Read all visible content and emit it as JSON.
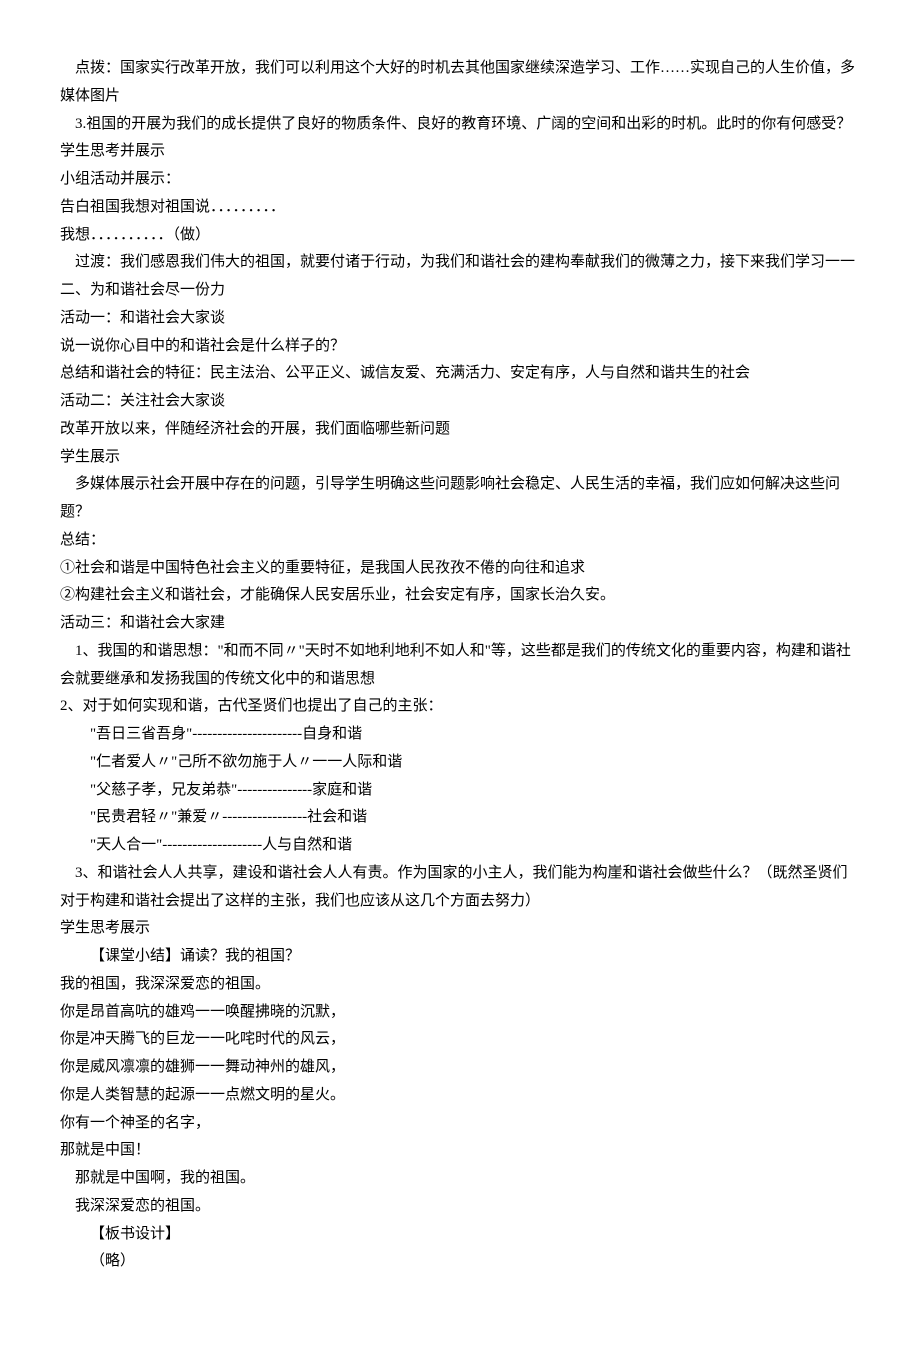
{
  "lines": [
    {
      "cls": "indent1",
      "text": "点拨：国家实行改革开放，我们可以利用这个大好的时机去其他国家继续深造学习、工作……实现自己的人生价值，多媒体图片"
    },
    {
      "cls": "indent1",
      "text": "3.祖国的开展为我们的成长提供了良好的物质条件、良好的教育环境、广阔的空间和出彩的时机。此时的你有何感受？"
    },
    {
      "cls": "",
      "text": "学生思考并展示"
    },
    {
      "cls": "",
      "text": "小组活动并展示："
    },
    {
      "cls": "",
      "text": "告白祖国我想对祖国说．．．．．．．．．"
    },
    {
      "cls": "",
      "text": "我想．．．．．．．．．．（做）"
    },
    {
      "cls": "indent1",
      "text": "过渡：我们感恩我们伟大的祖国，就要付诸于行动，为我们和谐社会的建构奉献我们的微薄之力，接下来我们学习一一"
    },
    {
      "cls": "",
      "text": "二、为和谐社会尽一份力"
    },
    {
      "cls": "",
      "text": "活动一：和谐社会大家谈"
    },
    {
      "cls": "",
      "text": "说一说你心目中的和谐社会是什么样子的？"
    },
    {
      "cls": "",
      "text": "总结和谐社会的特征：民主法治、公平正义、诚信友爱、充满活力、安定有序，人与自然和谐共生的社会"
    },
    {
      "cls": "",
      "text": "活动二：关注社会大家谈"
    },
    {
      "cls": "",
      "text": "改革开放以来，伴随经济社会的开展，我们面临哪些新问题"
    },
    {
      "cls": "",
      "text": "学生展示"
    },
    {
      "cls": "indent1",
      "text": "多媒体展示社会开展中存在的问题，引导学生明确这些问题影响社会稳定、人民生活的幸福，我们应如何解决这些问题？"
    },
    {
      "cls": "",
      "text": "总结："
    },
    {
      "cls": "",
      "text": "①社会和谐是中国特色社会主义的重要特征，是我国人民孜孜不倦的向往和追求"
    },
    {
      "cls": "",
      "text": "②构建社会主义和谐社会，才能确保人民安居乐业，社会安定有序，国家长治久安。"
    },
    {
      "cls": "",
      "text": "活动三：和谐社会大家建"
    },
    {
      "cls": "indent1",
      "text": "1、我国的和谐思想：\"和而不同〃\"天时不如地利地利不如人和\"等，这些都是我们的传统文化的重要内容，构建和谐社会就要继承和发扬我国的传统文化中的和谐思想"
    },
    {
      "cls": "",
      "text": "2、对于如何实现和谐，古代圣贤们也提出了自己的主张："
    },
    {
      "cls": "indent2",
      "text": "\"吾日三省吾身\"----------------------自身和谐"
    },
    {
      "cls": "indent2",
      "text": "\"仁者爱人〃\"己所不欲勿施于人〃一一人际和谐"
    },
    {
      "cls": "indent2",
      "text": "\"父慈子孝，兄友弟恭\"---------------家庭和谐"
    },
    {
      "cls": "indent2",
      "text": "\"民贵君轻〃\"兼爱〃-----------------社会和谐"
    },
    {
      "cls": "indent2",
      "text": "\"天人合一\"--------------------人与自然和谐"
    },
    {
      "cls": "indent1",
      "text": "3、和谐社会人人共享，建设和谐社会人人有责。作为国家的小主人，我们能为构崖和谐社会做些什么？（既然圣贤们对于构建和谐社会提出了这样的主张，我们也应该从这几个方面去努力）"
    },
    {
      "cls": "",
      "text": "学生思考展示"
    },
    {
      "cls": "indent2",
      "text": "【课堂小结】诵读？我的祖国？"
    },
    {
      "cls": "",
      "text": "我的祖国，我深深爱恋的祖国。"
    },
    {
      "cls": "",
      "text": "你是昂首高吭的雄鸡一一唤醒拂晓的沉默，"
    },
    {
      "cls": "",
      "text": "你是冲天腾飞的巨龙一一叱咤时代的风云，"
    },
    {
      "cls": "",
      "text": "你是威风凛凛的雄狮一一舞动神州的雄风，"
    },
    {
      "cls": "",
      "text": "你是人类智慧的起源一一点燃文明的星火。"
    },
    {
      "cls": "",
      "text": "你有一个神圣的名字，"
    },
    {
      "cls": "",
      "text": "那就是中国！"
    },
    {
      "cls": "indent1",
      "text": "那就是中国啊，我的祖国。"
    },
    {
      "cls": "indent1",
      "text": "我深深爱恋的祖国。"
    },
    {
      "cls": "indent2",
      "text": "【板书设计】"
    },
    {
      "cls": "indent2",
      "text": "（略）"
    }
  ]
}
